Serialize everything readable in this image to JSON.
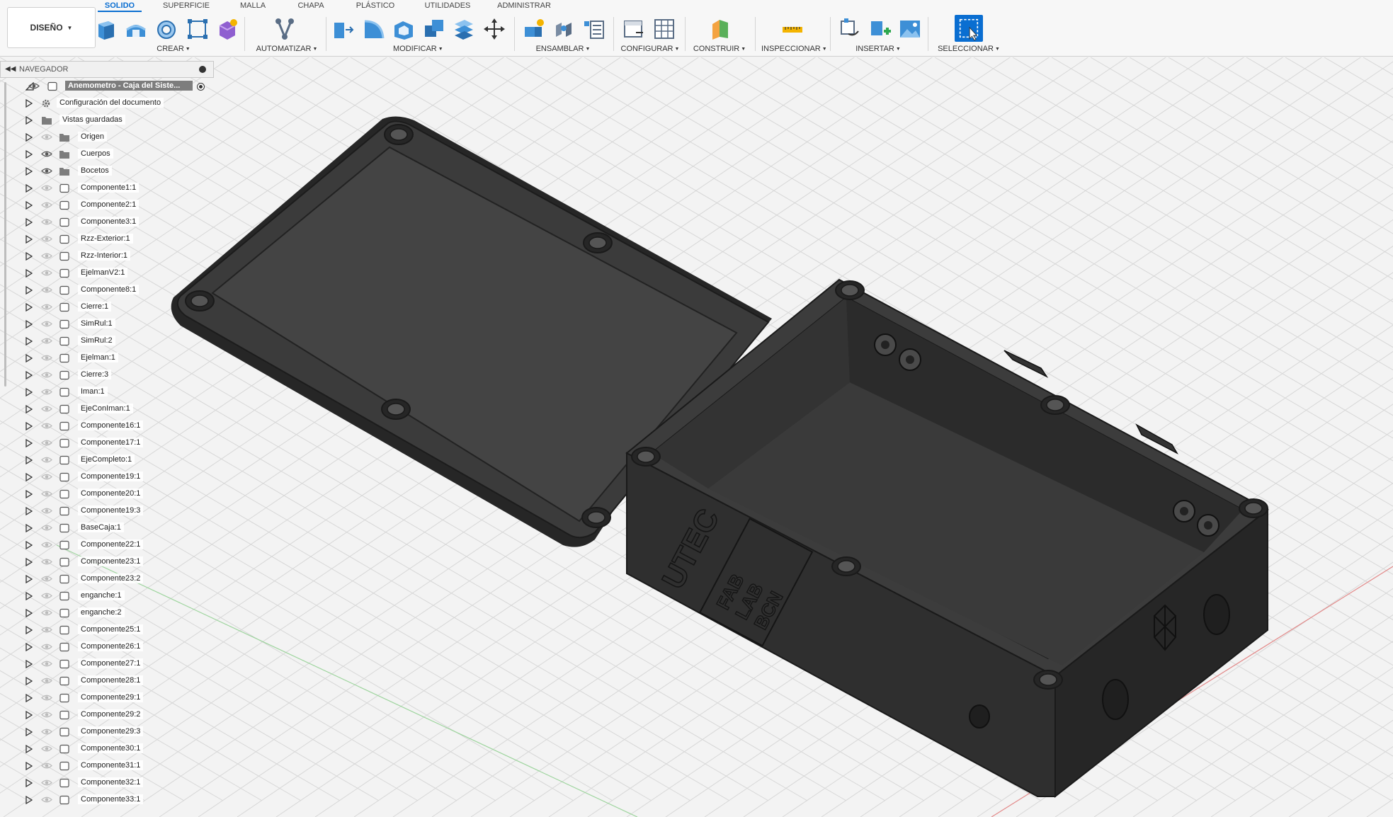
{
  "workspace": {
    "label": "DISEÑO"
  },
  "tabs": [
    "SOLIDO",
    "SUPERFICIE",
    "MALLA",
    "CHAPA",
    "PLÁSTICO",
    "UTILIDADES",
    "ADMINISTRAR"
  ],
  "active_tab": "SOLIDO",
  "groups": [
    "CREAR",
    "AUTOMATIZAR",
    "MODIFICAR",
    "ENSAMBLAR",
    "CONFIGURAR",
    "CONSTRUIR",
    "INSPECCIONAR",
    "INSERTAR",
    "SELECCIONAR"
  ],
  "navigator": {
    "title": "NAVEGADOR",
    "root": "Anemometro - Caja del Siste...",
    "document_settings": "Configuración del documento",
    "saved_views": "Vistas guardadas",
    "folders": [
      "Origen",
      "Cuerpos",
      "Bocetos"
    ],
    "components": [
      "Componente1:1",
      "Componente2:1",
      "Componente3:1",
      "Rzz-Exterior:1",
      "Rzz-Interior:1",
      "EjelmanV2:1",
      "Componente8:1",
      "Cierre:1",
      "SimRul:1",
      "SimRul:2",
      "Ejelman:1",
      "Cierre:3",
      "Iman:1",
      "EjeConIman:1",
      "Componente16:1",
      "Componente17:1",
      "EjeCompleto:1",
      "Componente19:1",
      "Componente20:1",
      "Componente19:3",
      "BaseCaja:1",
      "Componente22:1",
      "Componente23:1",
      "Componente23:2",
      "enganche:1",
      "enganche:2",
      "Componente25:1",
      "Componente26:1",
      "Componente27:1",
      "Componente28:1",
      "Componente29:1",
      "Componente29:2",
      "Componente29:3",
      "Componente30:1",
      "Componente31:1",
      "Componente32:1",
      "Componente33:1"
    ]
  },
  "model": {
    "engraving_utec": "UTEC",
    "engraving_fablab": [
      "FAB",
      "LAB",
      "BCN"
    ]
  },
  "colors": {
    "accent": "#0a6ed1",
    "model": "#3a3a3a",
    "grid": "#d6d6d6"
  }
}
